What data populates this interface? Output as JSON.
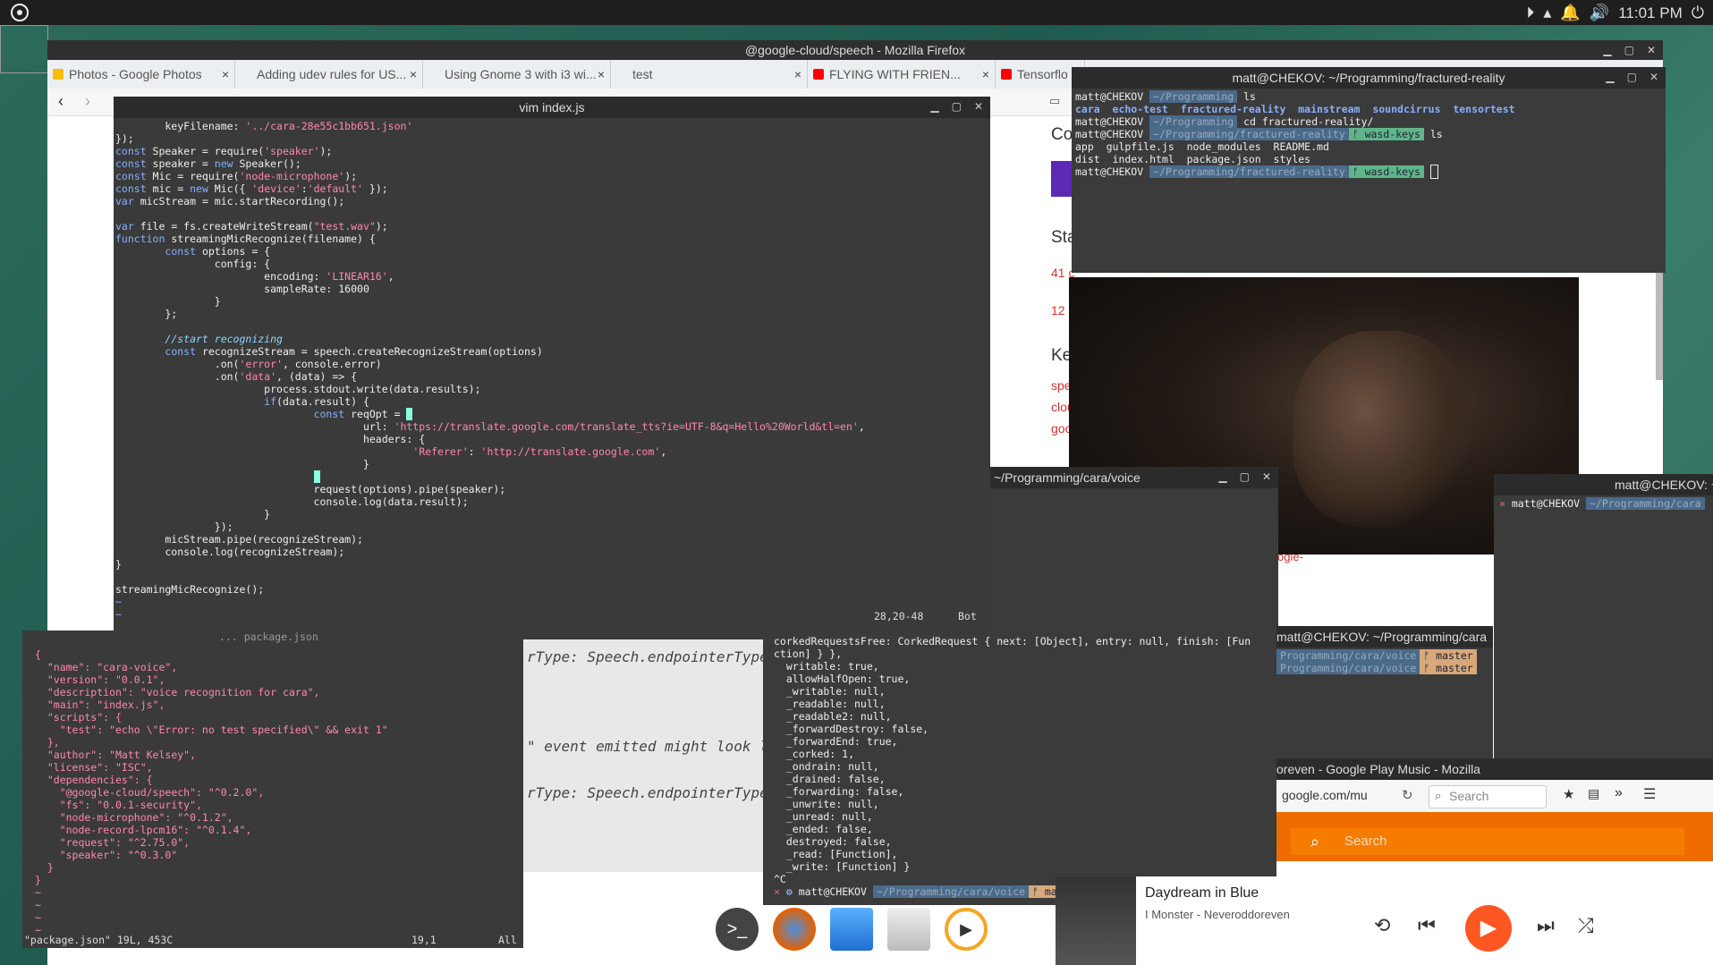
{
  "topbar": {
    "clock": "11:01 PM"
  },
  "firefox": {
    "title": "@google-cloud/speech - Mozilla Firefox",
    "tabs": [
      {
        "label": "Photos - Google Photos",
        "color": "#fbbc05"
      },
      {
        "label": "Adding udev rules for US...",
        "color": "#f48024"
      },
      {
        "label": "Using Gnome 3 with i3 wi...",
        "color": "#888888"
      },
      {
        "label": "test",
        "color": "#ffffff"
      },
      {
        "label": "FLYING WITH FRIEN...",
        "color": "#ff0000"
      },
      {
        "label": "Tensorflo",
        "color": "#ff0000"
      }
    ],
    "page_fragments": [
      "Col",
      "Sta",
      "41 c",
      "12 c",
      "Ke",
      "spe",
      "clou",
      "goo",
      "ogle-"
    ]
  },
  "vim_index": {
    "title": "vim index.js",
    "status_pos": "28,20-48",
    "status_scroll": "Bot"
  },
  "vim_pkg": {
    "header": "... package.json",
    "lines": [
      "{",
      "  \"name\": \"cara-voice\",",
      "  \"version\": \"0.0.1\",",
      "  \"description\": \"voice recognition for cara\",",
      "  \"main\": \"index.js\",",
      "  \"scripts\": {",
      "    \"test\": \"echo \\\"Error: no test specified\\\" && exit 1\"",
      "  },",
      "  \"author\": \"Matt Kelsey\",",
      "  \"license\": \"ISC\",",
      "  \"dependencies\": {",
      "    \"@google-cloud/speech\": \"^0.2.0\",",
      "    \"fs\": \"0.0.1-security\",",
      "    \"node-microphone\": \"^0.1.2\",",
      "    \"node-record-lpcm16\": \"^0.1.4\",",
      "    \"request\": \"^2.75.0\",",
      "    \"speaker\": \"^0.3.0\"",
      "  }",
      "}",
      "~",
      "~",
      "~",
      "~"
    ],
    "status_file": "\"package.json\" 19L, 453C",
    "status_pos": "19,1",
    "status_scroll": "All"
  },
  "docpanel": {
    "lines": [
      "rType: Speech.endpointerType",
      "\" event emitted might look l",
      "rType: Speech.endpointerType"
    ]
  },
  "term_fr": {
    "title": "matt@CHEKOV: ~/Programming/fractured-reality",
    "user": "matt@CHEKOV",
    "p1": "~/Programming",
    "cmd1": "ls",
    "dirs1": [
      "cara",
      "echo-test",
      "fractured-reality",
      "mainstream",
      "soundcirrus",
      "tensortest"
    ],
    "cmd2": "cd fractured-reality/",
    "p2": "~/Programming/fractured-reality",
    "branch": "wasd-keys",
    "cmd3": "ls",
    "ls2a": [
      "app",
      "gulpfile.js",
      "node_modules",
      "README.md"
    ],
    "ls2b": [
      "dist",
      "index.html",
      "package.json",
      "styles"
    ]
  },
  "term_voice": {
    "title": "~/Programming/cara/voice",
    "log": [
      "corkedRequestsFree: CorkedRequest { next: [Object], entry: null, finish: [Fun",
      "ction] } },",
      "  writable: true,",
      "  allowHalfOpen: true,",
      "  _writable: null,",
      "  _readable: null,",
      "  _readable2: null,",
      "  _forwardDestroy: false,",
      "  _forwardEnd: true,",
      "  _corked: 1,",
      "  _ondrain: null,",
      "  _drained: false,",
      "  _forwarding: false,",
      "  _unwrite: null,",
      "  _unread: null,",
      "  _ended: false,",
      "  destroyed: false,",
      "  _read: [Function],",
      "  _write: [Function] }",
      "^C"
    ],
    "prompt_user": "matt@CHEKOV",
    "prompt_path": "~/Programming/cara/voice",
    "prompt_branch": "master"
  },
  "term_right": {
    "title": "matt@CHEKOV: ~/Pr",
    "user": "matt@CHEKOV",
    "path": "~/Programming/cara"
  },
  "term_mid": {
    "title": "matt@CHEKOV: ~/Programming/cara",
    "path": "Programming/cara/voice",
    "branch": "master"
  },
  "gpm": {
    "title": "oreven - Google Play Music - Mozilla",
    "url": "google.com/mu",
    "search_placeholder": "Search",
    "app_search": "Search",
    "track": "Daydream in Blue",
    "artist": "I Monster - Neveroddoreven"
  }
}
